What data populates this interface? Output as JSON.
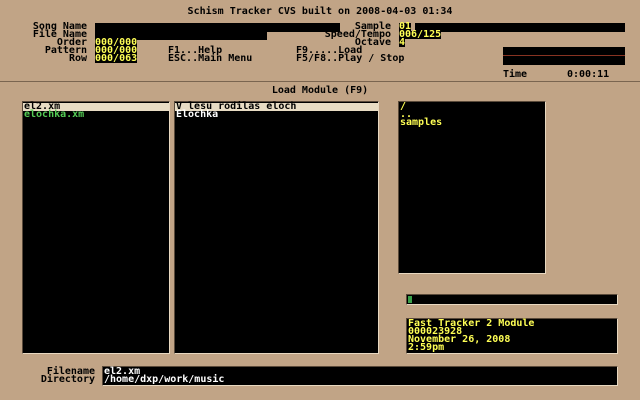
{
  "title": "Schism Tracker CVS built on 2008-04-03 01:34",
  "labels": {
    "song_name": "Song Name",
    "file_name": "File Name",
    "order": "Order",
    "pattern": "Pattern",
    "row": "Row",
    "sample": "Sample",
    "speed_tempo": "Speed/Tempo",
    "octave": "Octave",
    "time": "Time",
    "filename": "Filename",
    "directory": "Directory"
  },
  "values": {
    "song_name": "",
    "file_name": "",
    "order": "000/000",
    "pattern": "000/000",
    "row": "000/063",
    "sample": "01",
    "speed_tempo": "006/125",
    "octave": "4",
    "time": "0:00:11"
  },
  "help": {
    "f1": "F1...Help",
    "esc": "ESC..Main Menu",
    "f9": "F9.....Load",
    "f5f8": "F5/F8..Play / Stop"
  },
  "dialog_title": "Load Module (F9)",
  "files": [
    {
      "name": "el2.xm",
      "selected": true
    },
    {
      "name": "elochka.xm",
      "selected": false
    }
  ],
  "song_titles": [
    {
      "title": "V lesu rodilas eloch",
      "selected": true
    },
    {
      "title": "Elochka",
      "selected": false
    }
  ],
  "directories": [
    "/",
    "..",
    "samples"
  ],
  "load_progress": 0.02,
  "file_info": {
    "type": "Fast Tracker 2 Module",
    "size": "000023928",
    "date": "November 26, 2008",
    "time": "2:59pm"
  },
  "input": {
    "filename": "el2.xm",
    "directory": "/home/dxp/work/music"
  },
  "colors": {
    "background": "#c1a486",
    "value_text": "#ffff55",
    "highlight_file": "#55cc55",
    "panel": "#000000"
  }
}
